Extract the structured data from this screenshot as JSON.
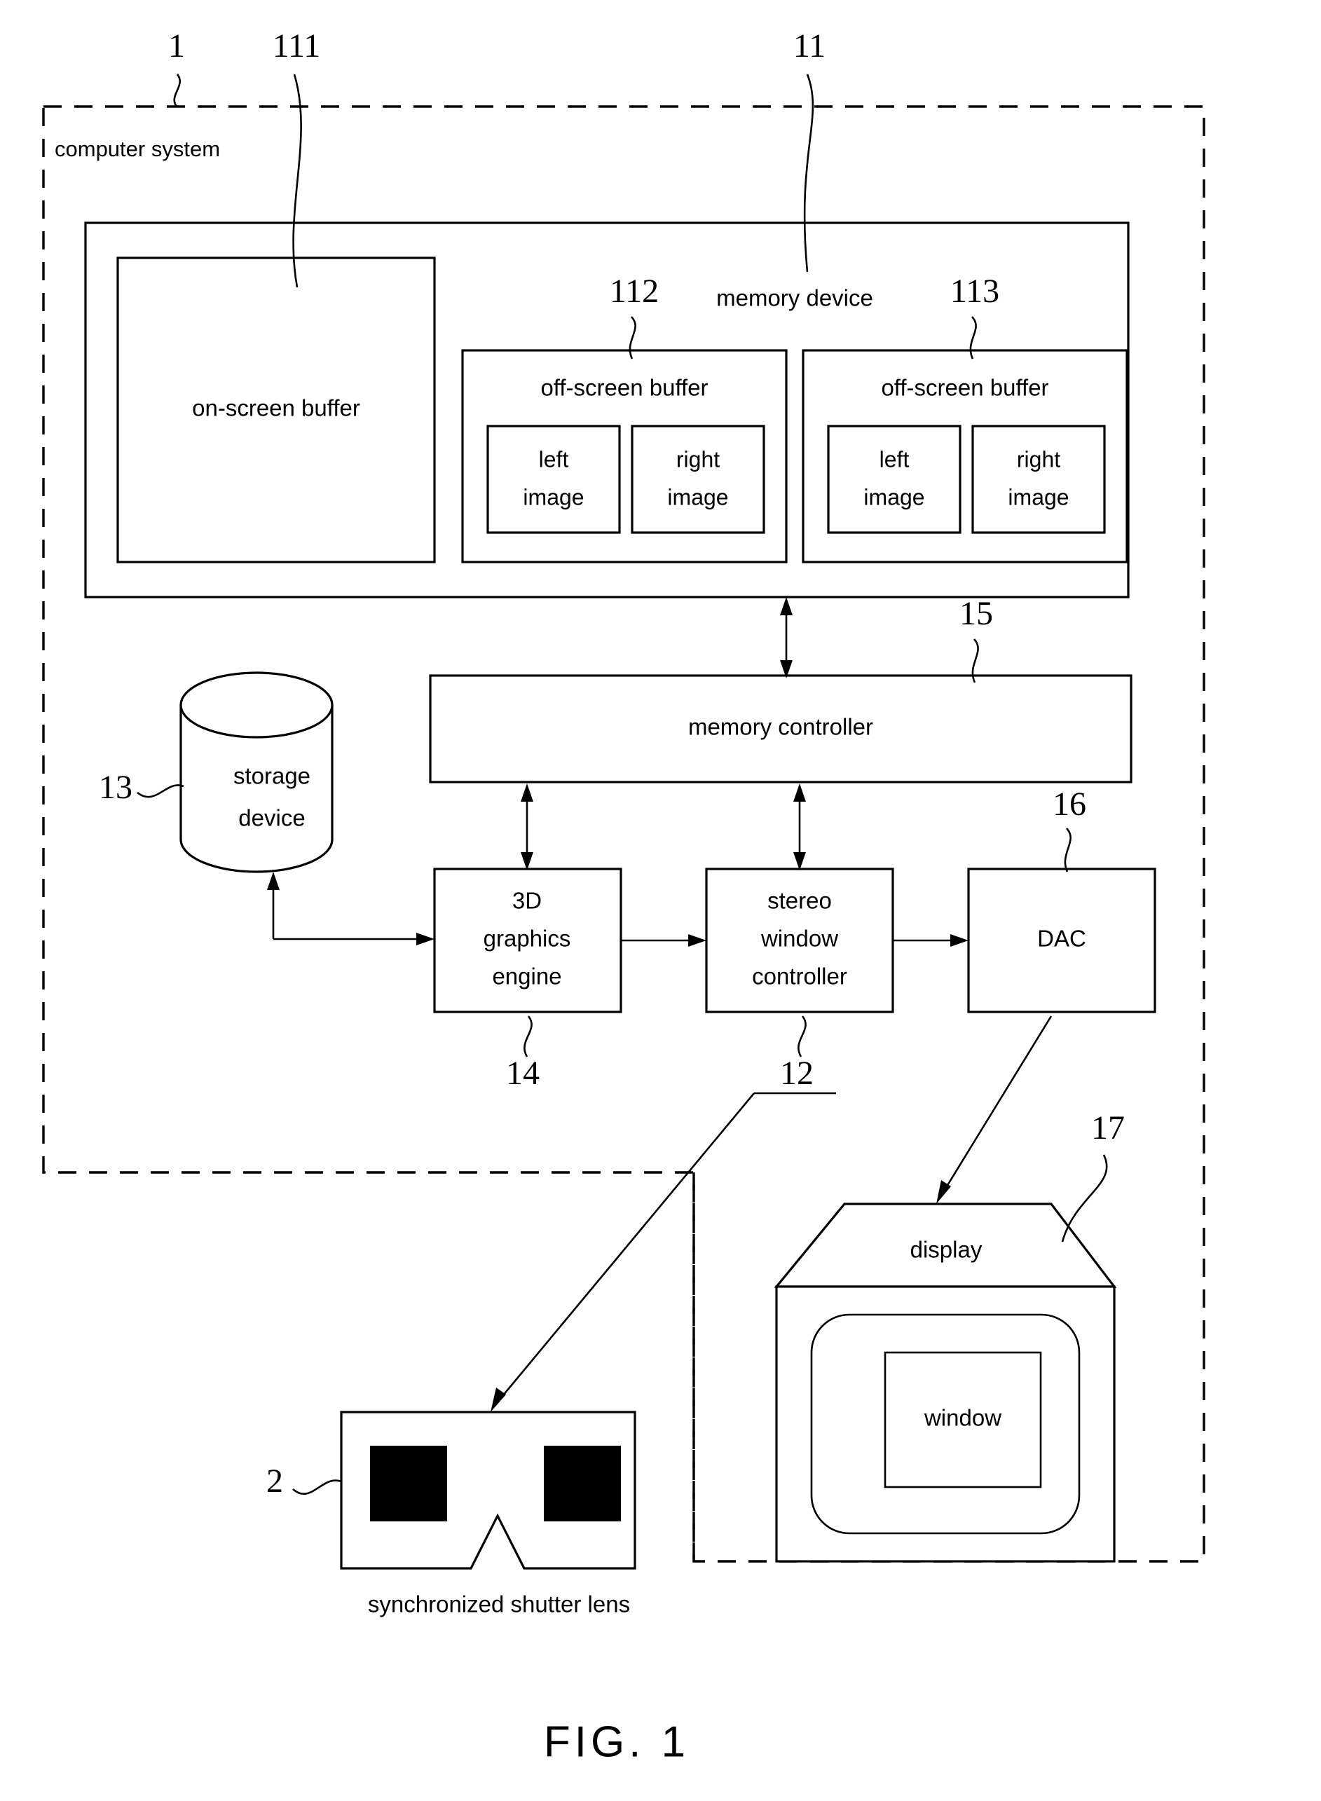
{
  "figure": {
    "caption": "FIG.  1",
    "system_label": "computer system",
    "refs": {
      "system": "1",
      "memory_device": "11",
      "on_screen_buffer": "111",
      "off_screen_buffer_a": "112",
      "off_screen_buffer_b": "113",
      "stereo_window_controller": "12",
      "storage_device": "13",
      "graphics_engine": "14",
      "memory_controller": "15",
      "dac": "16",
      "display": "17",
      "shutter_lens": "2"
    }
  },
  "memory_device": {
    "title": "memory device",
    "on_screen_buffer": {
      "label": "on-screen buffer"
    },
    "off_screen_buffers": [
      {
        "label": "off-screen buffer",
        "images": [
          {
            "line1": "left",
            "line2": "image"
          },
          {
            "line1": "right",
            "line2": "image"
          }
        ]
      },
      {
        "label": "off-screen buffer",
        "images": [
          {
            "line1": "left",
            "line2": "image"
          },
          {
            "line1": "right",
            "line2": "image"
          }
        ]
      }
    ]
  },
  "storage_device": {
    "line1": "storage",
    "line2": "device"
  },
  "memory_controller": {
    "label": "memory controller"
  },
  "pipeline": [
    {
      "name": "graphics-engine",
      "lines": [
        "3D",
        "graphics",
        "engine"
      ]
    },
    {
      "name": "stereo-window-controller",
      "lines": [
        "stereo",
        "window",
        "controller"
      ]
    },
    {
      "name": "dac",
      "lines": [
        "DAC"
      ]
    }
  ],
  "display": {
    "label": "display",
    "window_label": "window"
  },
  "shutter_lens": {
    "caption": "synchronized shutter lens"
  },
  "colors": {
    "line": "#000000",
    "background": "#ffffff",
    "lens_fill": "#000000"
  }
}
